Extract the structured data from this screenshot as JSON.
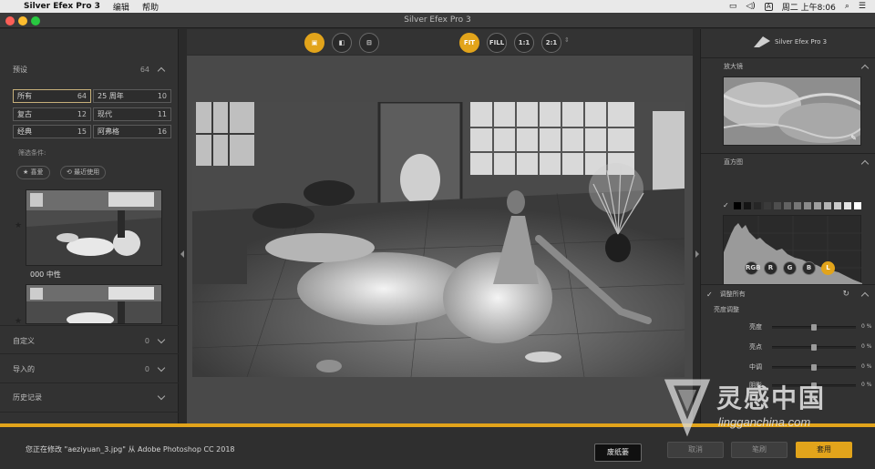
{
  "menubar": {
    "app_name": "Silver Efex Pro 3",
    "menus": [
      "编辑",
      "帮助"
    ],
    "input_badge": "A",
    "clock": "周二 上午8:06"
  },
  "window": {
    "title": "Silver Efex Pro 3"
  },
  "left_panel": {
    "presets_label": "预设",
    "presets_count": "64",
    "categories": [
      {
        "label": "所有",
        "count": "64",
        "selected": true
      },
      {
        "label": "25 周年",
        "count": "10",
        "selected": false
      },
      {
        "label": "复古",
        "count": "12",
        "selected": false
      },
      {
        "label": "现代",
        "count": "11",
        "selected": false
      },
      {
        "label": "经典",
        "count": "15",
        "selected": false
      },
      {
        "label": "阿弗格",
        "count": "16",
        "selected": false
      }
    ],
    "filter_label": "筛选条件:",
    "filter_favorites": "喜爱",
    "filter_recent": "最近使用",
    "preset_name": "000 中性",
    "custom_label": "自定义",
    "custom_count": "0",
    "imported_label": "导入的",
    "imported_count": "0",
    "history_label": "历史记录"
  },
  "toolbar": {
    "fit": "FIT",
    "fill": "FILL",
    "one_to_one": "1:1",
    "two_to_one": "2:1"
  },
  "right_panel": {
    "brand": "Silver Efex Pro 3",
    "loupe_label": "放大镜",
    "histogram_label": "直方图",
    "channels": [
      "RGB",
      "R",
      "G",
      "B",
      "L"
    ],
    "active_channel": "L",
    "adjust_all_label": "调整所有",
    "brightness_adjust_label": "亮度调整",
    "sliders": [
      {
        "label": "亮度",
        "value": "0 %",
        "level": 0.5
      },
      {
        "label": "亮点",
        "value": "0 %",
        "level": 0.5
      },
      {
        "label": "中调",
        "value": "0 %",
        "level": 0.5
      },
      {
        "label": "阴影",
        "value": "0 %",
        "level": 0.5
      }
    ]
  },
  "bottom": {
    "status": "您正在修改 \"aeziyuan_3.jpg\" 从 Adobe Photoshop CC 2018",
    "tooltip": "废纸篓",
    "cancel": "取消",
    "brush": "笔刷",
    "apply": "套用"
  },
  "watermark": {
    "brand": "灵感中国",
    "url": "lingganchina.com"
  },
  "colors": {
    "accent": "#e2a41b",
    "panel": "#323232",
    "canvas": "#494949"
  }
}
